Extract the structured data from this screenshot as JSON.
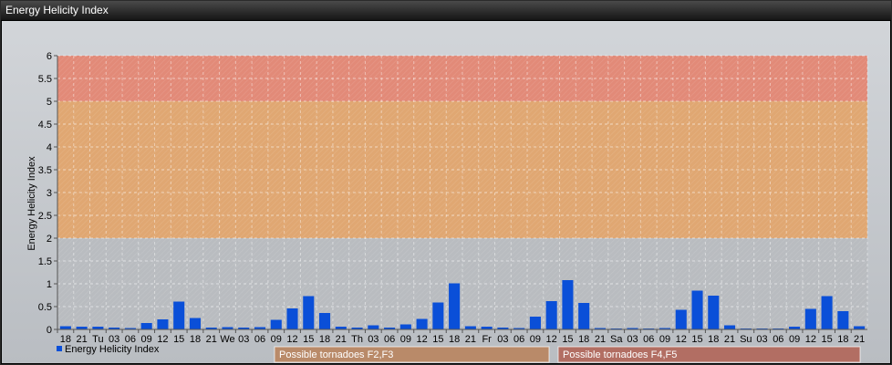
{
  "window": {
    "title": "Energy Helicity Index"
  },
  "chart_data": {
    "type": "bar",
    "title": "",
    "ylabel": "Energy Helicity Index",
    "xlabel": "",
    "ylim": [
      0,
      6
    ],
    "yticks": [
      "0",
      "0.5",
      "1",
      "1.5",
      "2",
      "2.5",
      "3",
      "3.5",
      "4",
      "4.5",
      "5",
      "5.5",
      "6"
    ],
    "categories": [
      "18",
      "21",
      "Tu",
      "03",
      "06",
      "09",
      "12",
      "15",
      "18",
      "21",
      "We",
      "03",
      "06",
      "09",
      "12",
      "15",
      "18",
      "21",
      "Th",
      "03",
      "06",
      "09",
      "12",
      "15",
      "18",
      "21",
      "Fr",
      "03",
      "06",
      "09",
      "12",
      "15",
      "18",
      "21",
      "Sa",
      "03",
      "06",
      "09",
      "12",
      "15",
      "18",
      "21",
      "Su",
      "03",
      "06",
      "09",
      "12",
      "15",
      "18",
      "21"
    ],
    "series": [
      {
        "name": "Energy Helicity Index",
        "color": "#0a4fd8",
        "values": [
          0.07,
          0.06,
          0.06,
          0.04,
          0.03,
          0.14,
          0.22,
          0.61,
          0.25,
          0.04,
          0.05,
          0.04,
          0.05,
          0.21,
          0.46,
          0.73,
          0.36,
          0.06,
          0.04,
          0.09,
          0.04,
          0.11,
          0.23,
          0.59,
          1.01,
          0.07,
          0.06,
          0.04,
          0.03,
          0.28,
          0.62,
          1.08,
          0.58,
          0.03,
          0.02,
          0.03,
          0.02,
          0.03,
          0.43,
          0.85,
          0.74,
          0.09,
          0.02,
          0.02,
          0.02,
          0.06,
          0.45,
          0.73,
          0.4,
          0.07
        ]
      }
    ],
    "bands": [
      {
        "from": 5,
        "to": 6,
        "color": "#e28a78"
      },
      {
        "from": 2,
        "to": 5,
        "color": "#e0a772"
      },
      {
        "from": 0,
        "to": 2,
        "color": "#b9bcc0"
      }
    ],
    "categories_legend": [
      {
        "label": "Possible tornadoes F2,F3",
        "color": "#b98a69"
      },
      {
        "label": "Possible tornadoes F4,F5",
        "color": "#b26e63"
      }
    ],
    "grid": true,
    "legend_position": "bottom-left"
  }
}
